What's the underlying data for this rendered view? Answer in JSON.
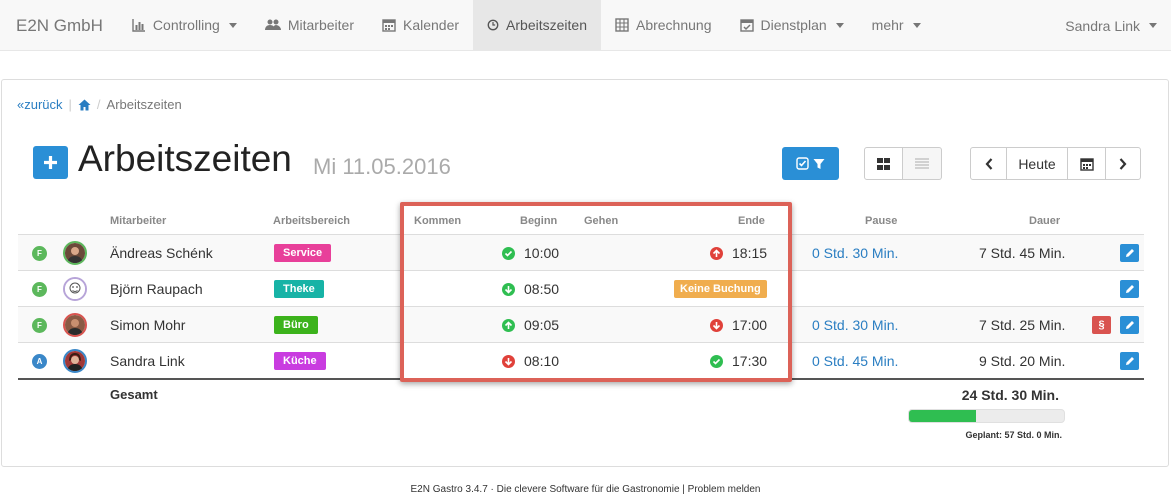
{
  "navbar": {
    "brand": "E2N GmbH",
    "items": [
      {
        "label": "Controlling",
        "icon": "bar-chart-icon"
      },
      {
        "label": "Mitarbeiter",
        "icon": "users-icon"
      },
      {
        "label": "Kalender",
        "icon": "calendar-icon"
      },
      {
        "label": "Arbeitszeiten",
        "icon": "clock-icon"
      },
      {
        "label": "Abrechnung",
        "icon": "table-icon"
      },
      {
        "label": "Dienstplan",
        "icon": "calendar-check-icon"
      },
      {
        "label": "mehr"
      }
    ],
    "user": "Sandra Link"
  },
  "breadcrumb": {
    "back": "zurück",
    "current": "Arbeitszeiten"
  },
  "page": {
    "title": "Arbeitszeiten",
    "date": "Mi 11.05.2016"
  },
  "toolbar": {
    "today": "Heute"
  },
  "table": {
    "headers": {
      "mitarbeiter": "Mitarbeiter",
      "bereich": "Arbeitsbereich",
      "kommen": "Kommen",
      "beginn": "Beginn",
      "gehen": "Gehen",
      "ende": "Ende",
      "pause": "Pause",
      "dauer": "Dauer"
    },
    "rows": [
      {
        "status": "F",
        "name": "Ändreas Schénk",
        "area": "Service",
        "begin": "10:00",
        "end": "18:15",
        "pause": "0 Std. 30 Min.",
        "duration": "7 Std. 45 Min."
      },
      {
        "status": "F",
        "name": "Björn Raupach",
        "area": "Theke",
        "begin": "08:50",
        "end_badge": "Keine Buchung"
      },
      {
        "status": "F",
        "name": "Simon Mohr",
        "area": "Büro",
        "begin": "09:05",
        "end": "17:00",
        "pause": "0 Std. 30 Min.",
        "duration": "7 Std. 25 Min.",
        "flag": "§"
      },
      {
        "status": "A",
        "name": "Sandra Link",
        "area": "Küche",
        "begin": "08:10",
        "end": "17:30",
        "pause": "0 Std. 45 Min.",
        "duration": "9 Std. 20 Min."
      }
    ],
    "total_label": "Gesamt",
    "total_value": "24 Std. 30 Min.",
    "planned": "Geplant: 57 Std. 0 Min.",
    "progress_fraction": 0.43
  },
  "colors": {
    "service": "#e8409a",
    "theke": "#17b3a6",
    "buero": "#3cb31c",
    "kueche": "#c93ce0",
    "accent": "#2a8fd6",
    "highlight": "#dc6258"
  },
  "footer": "E2N Gastro 3.4.7 · Die clevere Software für die Gastronomie | Problem melden"
}
